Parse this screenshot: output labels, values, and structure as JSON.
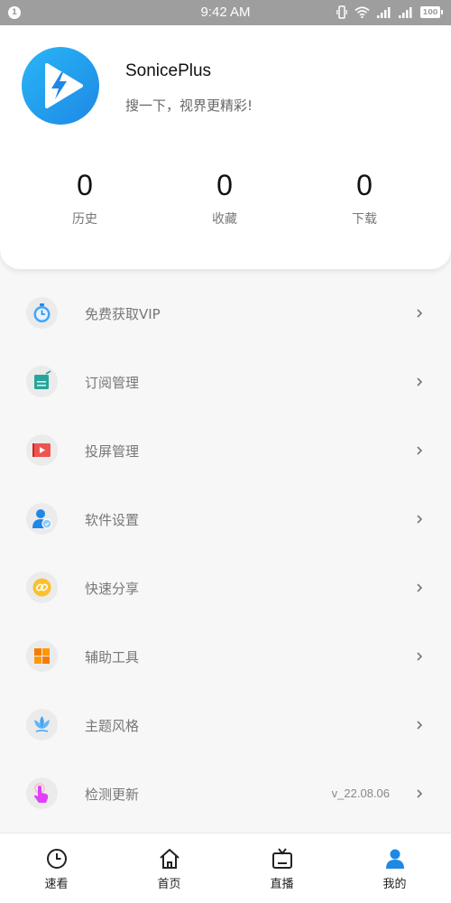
{
  "status_bar": {
    "notification_count": "1",
    "time": "9:42 AM",
    "battery": "100"
  },
  "profile": {
    "app_name": "SonicePlus",
    "slogan": "搜一下，视界更精彩!",
    "logo_icon": "play-bolt-icon"
  },
  "stats": [
    {
      "value": "0",
      "label": "历史"
    },
    {
      "value": "0",
      "label": "收藏"
    },
    {
      "value": "0",
      "label": "下载"
    }
  ],
  "menu": [
    {
      "label": "免费获取VIP",
      "icon": "stopwatch-icon",
      "value": ""
    },
    {
      "label": "订阅管理",
      "icon": "subscription-icon",
      "value": ""
    },
    {
      "label": "投屏管理",
      "icon": "cast-screen-icon",
      "value": ""
    },
    {
      "label": "软件设置",
      "icon": "user-settings-icon",
      "value": ""
    },
    {
      "label": "快速分享",
      "icon": "link-icon",
      "value": ""
    },
    {
      "label": "辅助工具",
      "icon": "grid-tools-icon",
      "value": ""
    },
    {
      "label": "主题风格",
      "icon": "lotus-icon",
      "value": ""
    },
    {
      "label": "检测更新",
      "icon": "tap-update-icon",
      "value": "v_22.08.06"
    }
  ],
  "tabs": [
    {
      "label": "速看",
      "icon": "clock-icon",
      "active": false
    },
    {
      "label": "首页",
      "icon": "home-icon",
      "active": false
    },
    {
      "label": "直播",
      "icon": "tv-icon",
      "active": false
    },
    {
      "label": "我的",
      "icon": "person-icon",
      "active": true
    }
  ],
  "colors": {
    "accent": "#1e88e5",
    "status_bar": "#9e9e9e",
    "background": "#f7f7f7"
  }
}
